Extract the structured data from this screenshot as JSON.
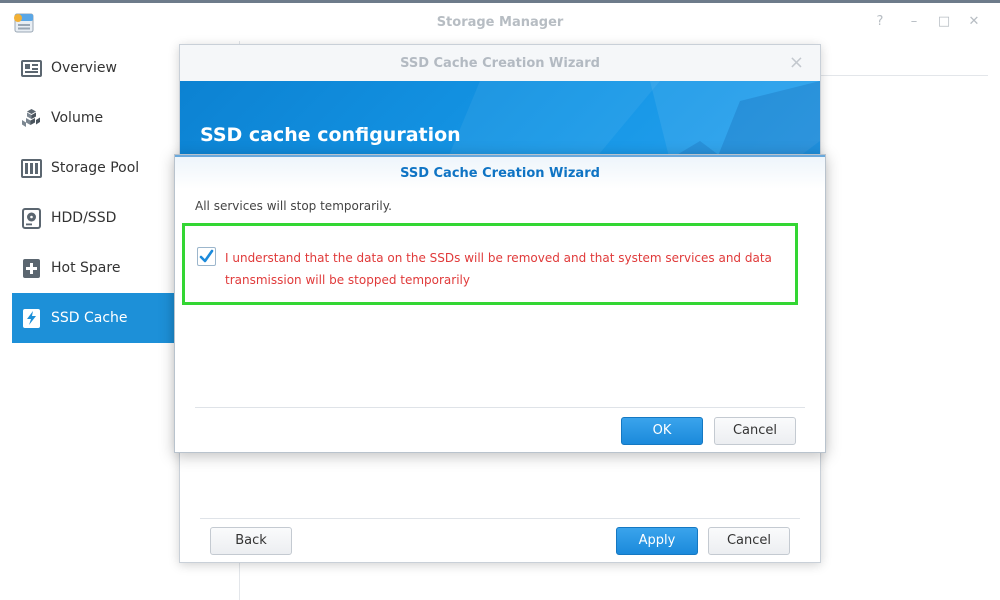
{
  "window": {
    "title": "Storage Manager",
    "controls": {
      "help": "?",
      "minimize": "–",
      "maximize": "□",
      "close": "✕"
    }
  },
  "sidebar": {
    "items": [
      {
        "label": "Overview",
        "icon": "overview-icon",
        "active": false
      },
      {
        "label": "Volume",
        "icon": "volume-icon",
        "active": false
      },
      {
        "label": "Storage Pool",
        "icon": "storage-pool-icon",
        "active": false
      },
      {
        "label": "HDD/SSD",
        "icon": "hdd-icon",
        "active": false
      },
      {
        "label": "Hot Spare",
        "icon": "hot-spare-icon",
        "active": false
      },
      {
        "label": "SSD Cache",
        "icon": "ssd-cache-icon",
        "active": true
      }
    ]
  },
  "wizard": {
    "title": "SSD Cache Creation Wizard",
    "step_title": "SSD cache configuration",
    "back_label": "Back",
    "apply_label": "Apply",
    "cancel_label": "Cancel"
  },
  "dialog": {
    "title": "SSD Cache Creation Wizard",
    "message": "All services will stop temporarily.",
    "agreement_text": "I understand that the data on the SSDs will be removed and that system services and data transmission will be stopped temporarily",
    "agreement_checked": true,
    "ok_label": "OK",
    "cancel_label": "Cancel"
  },
  "colors": {
    "accent": "#1d90d8",
    "warning_text": "#e03a3a",
    "highlight_border": "#33d633",
    "dialog_title": "#0f74c4"
  }
}
